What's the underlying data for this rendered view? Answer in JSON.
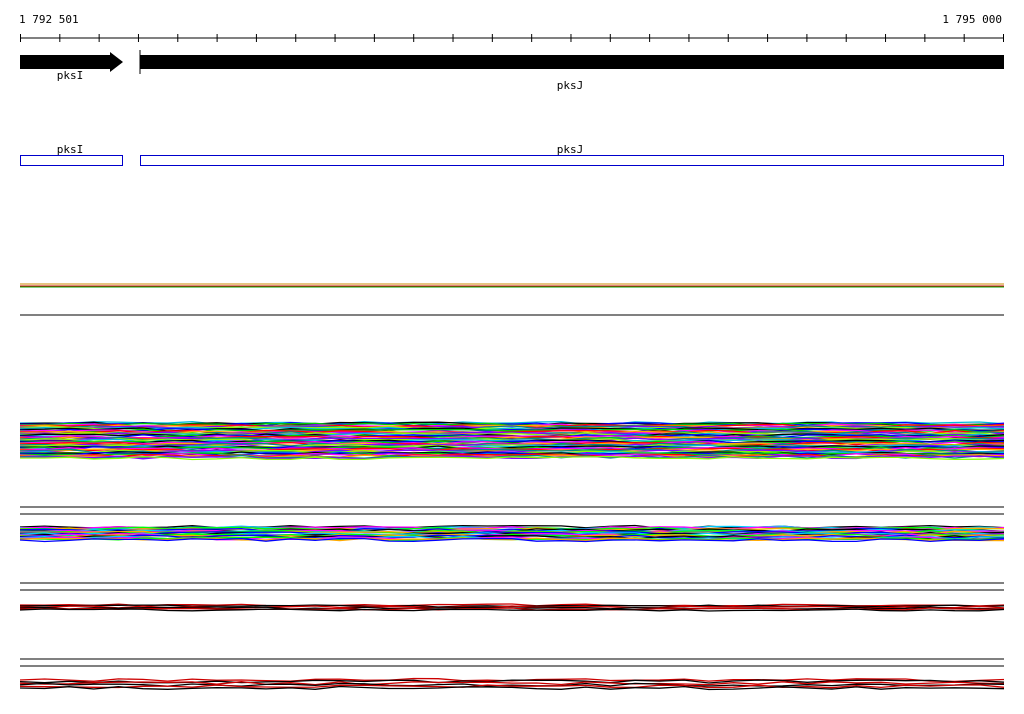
{
  "ruler": {
    "start_label": "1 792 501",
    "end_label": "1 795 000"
  },
  "genes": [
    {
      "name": "pksI",
      "color": "#000000",
      "strand": "+"
    },
    {
      "name": "pksJ",
      "color": "#000000",
      "strand": "+"
    }
  ],
  "gene_boxes": [
    {
      "name": "pksI",
      "color": "#0000cc"
    },
    {
      "name": "pksJ",
      "color": "#0000cc"
    }
  ],
  "tracks": [
    {
      "id": "track-1",
      "colors": [
        "#cc8800",
        "#cc0000",
        "#00aa00"
      ]
    },
    {
      "id": "track-2",
      "colors": [
        "#00bbdd",
        "#000000",
        "#0000ff",
        "#00cc00",
        "#ff00ff",
        "#ff0000",
        "#ffaa00",
        "#008888",
        "#8800ff",
        "#88ff00"
      ]
    },
    {
      "id": "track-3",
      "colors": [
        "#000000",
        "#00ccff",
        "#ff00ff",
        "#00ff00",
        "#ffaa00",
        "#0000ff"
      ]
    },
    {
      "id": "track-4",
      "colors": [
        "#cc0000",
        "#000000"
      ]
    },
    {
      "id": "track-5",
      "colors": [
        "#cc0000",
        "#000000"
      ]
    }
  ]
}
